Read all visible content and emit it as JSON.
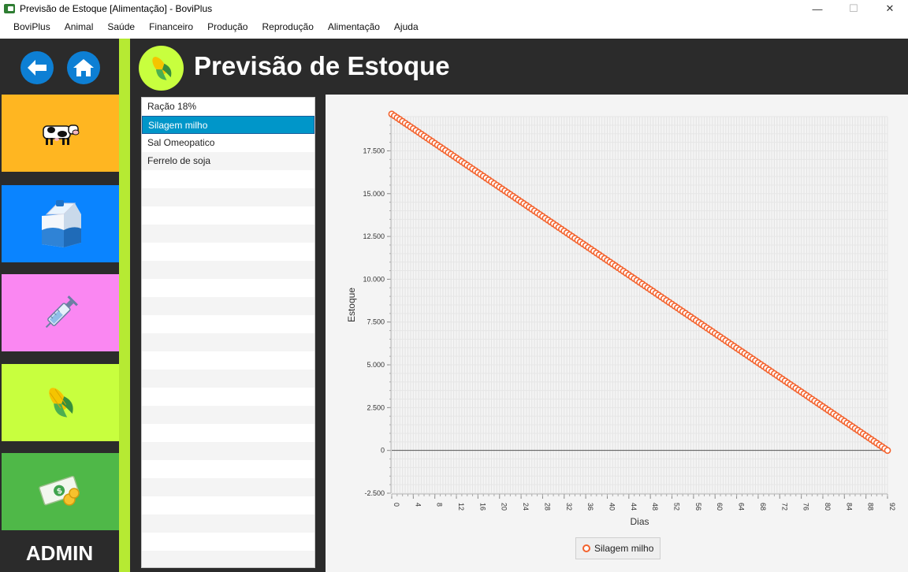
{
  "window": {
    "title": "Previsão de Estoque [Alimentação] - BoviPlus",
    "minimize": "—",
    "maximize": "☐",
    "close": "✕"
  },
  "menu": [
    "BoviPlus",
    "Animal",
    "Saúde",
    "Financeiro",
    "Produção",
    "Reprodução",
    "Alimentação",
    "Ajuda"
  ],
  "sidebar": {
    "back_icon": "back-arrow-icon",
    "home_icon": "home-icon",
    "tiles": [
      {
        "name": "cattle",
        "icon": "cow-icon",
        "color": "#ffb621"
      },
      {
        "name": "milk",
        "icon": "milk-carton-icon",
        "color": "#0a84ff"
      },
      {
        "name": "health",
        "icon": "syringe-icon",
        "color": "#fa87f2"
      },
      {
        "name": "feed",
        "icon": "corn-icon",
        "color": "#c8ff3e"
      },
      {
        "name": "finance",
        "icon": "money-icon",
        "color": "#4fb848"
      }
    ],
    "admin_label": "ADMIN"
  },
  "header": {
    "title": "Previsão de Estoque",
    "icon": "corn-icon"
  },
  "feed_list": {
    "items": [
      "Ração 18%",
      "Silagem milho",
      "Sal Omeopatico",
      "Ferrelo de soja"
    ],
    "selected_index": 1
  },
  "chart_data": {
    "type": "line",
    "xlabel": "Dias",
    "ylabel": "Estoque",
    "xlim": [
      0,
      92
    ],
    "ylim": [
      -2500,
      19500
    ],
    "xticks": [
      "0",
      "4",
      "8",
      "12",
      "16",
      "20",
      "24",
      "28",
      "32",
      "36",
      "40",
      "44",
      "48",
      "52",
      "56",
      "60",
      "64",
      "68",
      "72",
      "76",
      "80",
      "84",
      "88",
      "92"
    ],
    "yticks": [
      "-2.500",
      "0",
      "2.500",
      "5.000",
      "7.500",
      "10.000",
      "12.500",
      "15.000",
      "17.500"
    ],
    "ytick_values": [
      -2500,
      0,
      2500,
      5000,
      7500,
      10000,
      12500,
      15000,
      17500
    ],
    "series": [
      {
        "name": "Silagem milho",
        "color": "#f3622d",
        "x_start": 0,
        "x_end": 92,
        "x_step": 0.5,
        "y_start": 19650,
        "y_end": 0
      }
    ],
    "legend_position": "bottom-center",
    "grid": true
  }
}
